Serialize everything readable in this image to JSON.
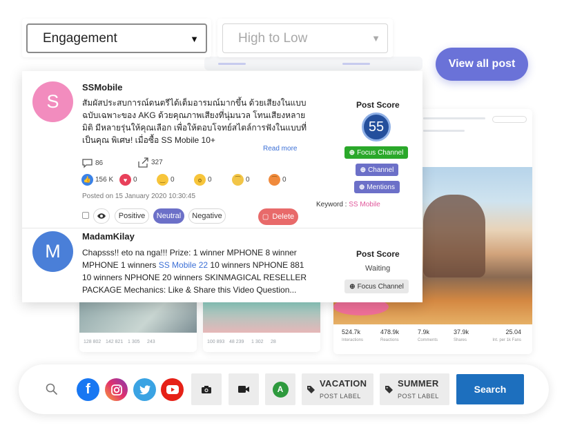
{
  "filters": {
    "sort_by": "Engagement",
    "order_placeholder": "High to Low"
  },
  "view_all_label": "View all post",
  "posts": [
    {
      "avatar_letter": "S",
      "author": "SSMobile",
      "text": "สัมผัสประสบการณ์ดนตรีได้เต็มอารมณ์มากขึ้น ด้วยเสียงในแบบฉบับเฉพาะของ AKG ด้วยคุณภาพเสียงที่นุ่มนวล โทนเสียงหลายมิติ มีหลายรุ่นให้คุณเลือก เพื่อให้ตอบโจทย์สไตล์การฟังในแบบที่เป็นคุณ พิเศษ! เมื่อซื้อ SS Mobile 10+",
      "read_more": "Read more",
      "comments": "86",
      "shares": "327",
      "reactions": {
        "like": "156 K",
        "love": "0",
        "haha": "0",
        "wow": "0",
        "sad": "0",
        "angry": "0"
      },
      "posted_on": "Posted on 15 January 2020 10:30:45",
      "sentiment_chips": [
        "Positive",
        "Neutral",
        "Negative"
      ],
      "delete_label": "Delete",
      "score_label": "Post Score",
      "score": "55",
      "focus_channel_label": "Focus Channel",
      "channel_label": "Channel",
      "mentions_label": "Mentions",
      "keyword_label": "Keyword :",
      "keyword": "SS Mobile"
    },
    {
      "avatar_letter": "M",
      "author": "MadamKilay",
      "text_before": "Chapsss!! eto na nga!!! Prize: 1 winner  MPHONE 8  winner MPHONE 1  winners ",
      "text_mention": "SS Mobile 22",
      "text_after": " 10 winners NPHONE 881 10 winners  NPHONE  20 winners SKINMAGICAL RESELLER PACKAGE Mechanics: Like & Share this Video Question...",
      "score_label": "Post Score",
      "score_status": "Waiting",
      "focus_channel_label": "Focus Channel"
    }
  ],
  "bg_card": {
    "stats": [
      {
        "value": "524.7k",
        "label": "Interactions"
      },
      {
        "value": "478.9k",
        "label": "Reactions"
      },
      {
        "value": "7.9k",
        "label": "Comments"
      },
      {
        "value": "37.9k",
        "label": "Shares"
      },
      {
        "value": "25.04",
        "label": "Int. per 1k Fans"
      }
    ],
    "small_nums_a": [
      "128 802",
      "142 821",
      "1 305",
      "243"
    ],
    "small_nums_b": [
      "100 893",
      "48 239",
      "1 302",
      "28"
    ]
  },
  "search_bar": {
    "labels": [
      {
        "title": "VACATION",
        "sub": "POST LABEL"
      },
      {
        "title": "SUMMER",
        "sub": "POST LABEL"
      }
    ],
    "avatar_letter": "A",
    "search_label": "Search"
  },
  "colors": {
    "accent": "#6a72d8",
    "score": "#244f9c",
    "focus_channel": "#2aa82a",
    "tag_purple": "#6c70c8",
    "delete": "#e86a6a",
    "search": "#1d6fbe",
    "avatar_s": "#f28cbe",
    "avatar_m": "#4a7fd8"
  }
}
